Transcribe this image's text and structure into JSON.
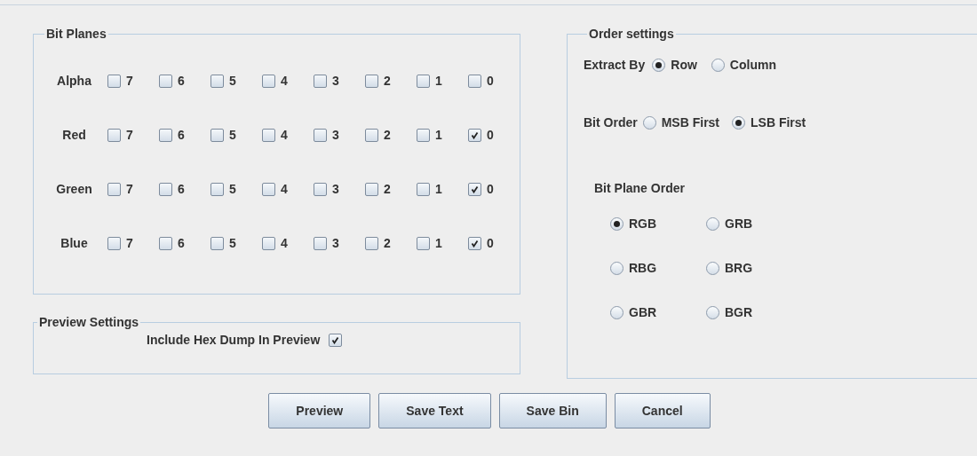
{
  "bit_planes": {
    "title": "Bit Planes",
    "channels": [
      {
        "name": "Alpha",
        "bits": [
          {
            "label": "7",
            "checked": false
          },
          {
            "label": "6",
            "checked": false
          },
          {
            "label": "5",
            "checked": false
          },
          {
            "label": "4",
            "checked": false
          },
          {
            "label": "3",
            "checked": false
          },
          {
            "label": "2",
            "checked": false
          },
          {
            "label": "1",
            "checked": false
          },
          {
            "label": "0",
            "checked": false
          }
        ]
      },
      {
        "name": "Red",
        "bits": [
          {
            "label": "7",
            "checked": false
          },
          {
            "label": "6",
            "checked": false
          },
          {
            "label": "5",
            "checked": false
          },
          {
            "label": "4",
            "checked": false
          },
          {
            "label": "3",
            "checked": false
          },
          {
            "label": "2",
            "checked": false
          },
          {
            "label": "1",
            "checked": false
          },
          {
            "label": "0",
            "checked": true
          }
        ]
      },
      {
        "name": "Green",
        "bits": [
          {
            "label": "7",
            "checked": false
          },
          {
            "label": "6",
            "checked": false
          },
          {
            "label": "5",
            "checked": false
          },
          {
            "label": "4",
            "checked": false
          },
          {
            "label": "3",
            "checked": false
          },
          {
            "label": "2",
            "checked": false
          },
          {
            "label": "1",
            "checked": false
          },
          {
            "label": "0",
            "checked": true
          }
        ]
      },
      {
        "name": "Blue",
        "bits": [
          {
            "label": "7",
            "checked": false
          },
          {
            "label": "6",
            "checked": false
          },
          {
            "label": "5",
            "checked": false
          },
          {
            "label": "4",
            "checked": false
          },
          {
            "label": "3",
            "checked": false
          },
          {
            "label": "2",
            "checked": false
          },
          {
            "label": "1",
            "checked": false
          },
          {
            "label": "0",
            "checked": true
          }
        ]
      }
    ]
  },
  "preview_settings": {
    "title": "Preview Settings",
    "hex_dump": {
      "label": "Include Hex Dump In Preview",
      "checked": true
    }
  },
  "order_settings": {
    "title": "Order settings",
    "extract_by": {
      "label": "Extract By",
      "options": [
        {
          "label": "Row",
          "selected": true
        },
        {
          "label": "Column",
          "selected": false
        }
      ]
    },
    "bit_order": {
      "label": "Bit Order",
      "options": [
        {
          "label": "MSB First",
          "selected": false
        },
        {
          "label": "LSB First",
          "selected": true
        }
      ]
    },
    "bit_plane_order": {
      "label": "Bit Plane Order",
      "options": [
        {
          "label": "RGB",
          "selected": true
        },
        {
          "label": "GRB",
          "selected": false
        },
        {
          "label": "RBG",
          "selected": false
        },
        {
          "label": "BRG",
          "selected": false
        },
        {
          "label": "GBR",
          "selected": false
        },
        {
          "label": "BGR",
          "selected": false
        }
      ]
    }
  },
  "buttons": [
    "Preview",
    "Save Text",
    "Save Bin",
    "Cancel"
  ]
}
